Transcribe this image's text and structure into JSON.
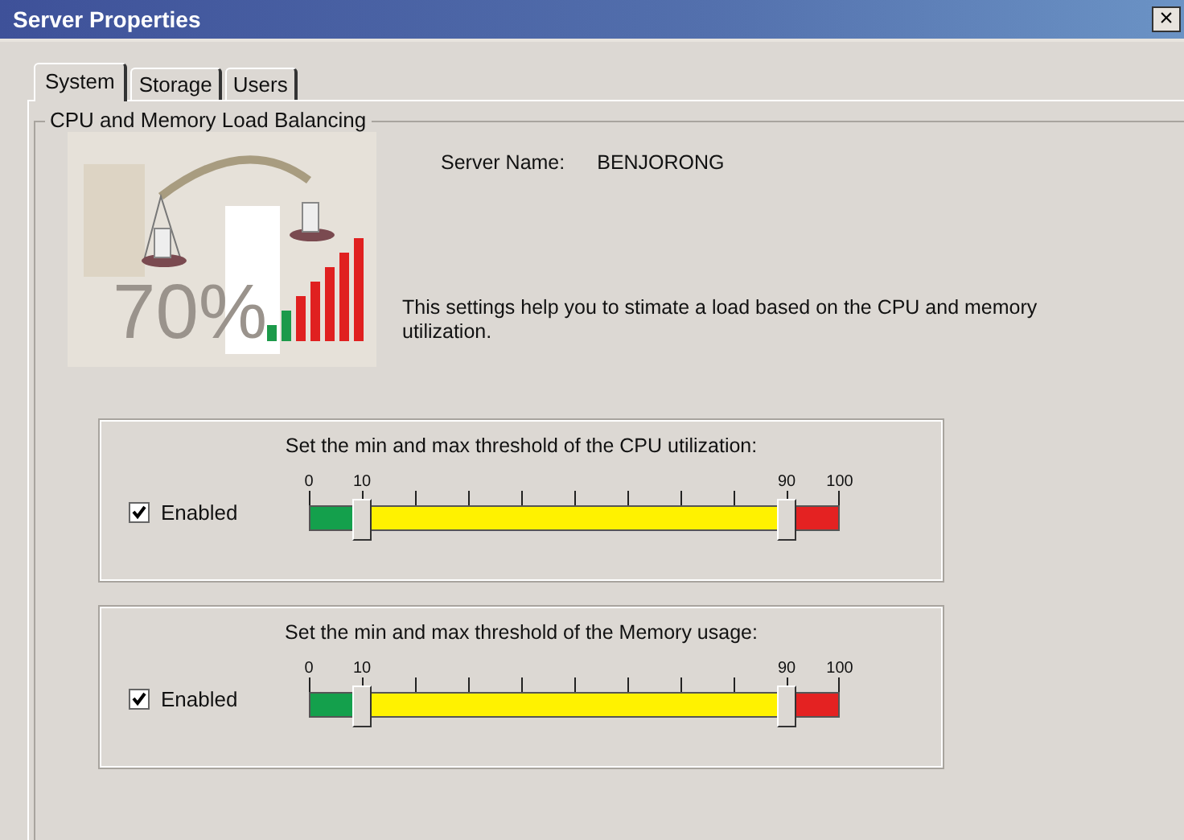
{
  "window": {
    "title": "Server Properties",
    "close": "×"
  },
  "tabs": [
    {
      "label": "System",
      "selected": true
    },
    {
      "label": "Storage",
      "selected": false
    },
    {
      "label": "Users",
      "selected": false
    }
  ],
  "group": {
    "title": "CPU and Memory Load Balancing",
    "illustration": {
      "percent": "70%"
    },
    "server_name": {
      "label": "Server Name:",
      "value": "BENJORONG"
    },
    "description": "This settings help you to stimate a load based on the CPU and memory utilization.",
    "panels": [
      {
        "caption": "Set the min and max threshold of the CPU utilization:",
        "enabled": {
          "label": "Enabled",
          "checked": true
        },
        "tick_labels": [
          "0",
          "10",
          "90",
          "100"
        ],
        "thumbs": [
          {
            "level": 0.1
          },
          {
            "level": 0.9
          }
        ]
      },
      {
        "caption": "Set the min and max threshold of the Memory usage:",
        "enabled": {
          "label": "Enabled",
          "checked": true
        },
        "tick_labels": [
          "0",
          "10",
          "90",
          "100"
        ],
        "thumbs": [
          {
            "level": 0.1
          },
          {
            "level": 0.9
          }
        ]
      }
    ]
  }
}
